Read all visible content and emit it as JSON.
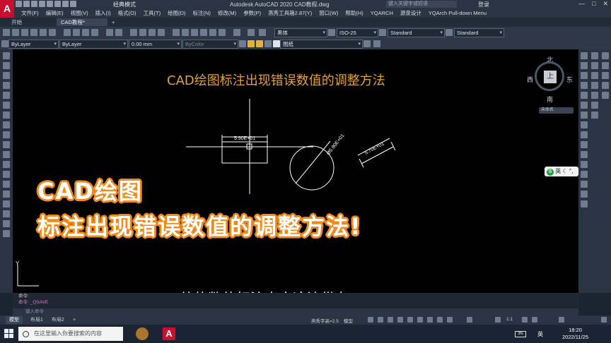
{
  "app": {
    "title": "Autodesk AutoCAD 2020    CAD教程.dwg",
    "logo": "A",
    "workspace": "经典模式",
    "search_placeholder": "键入关键字或短语",
    "login": "登录",
    "window_controls": [
      "—",
      "□",
      "✕"
    ]
  },
  "menu": {
    "items": [
      "文件(F)",
      "编辑(E)",
      "视图(V)",
      "插入(I)",
      "格式(O)",
      "工具(T)",
      "绘图(D)",
      "标注(N)",
      "修改(M)",
      "参数(P)",
      "燕秀工具箱2.87(Y)",
      "窗口(W)",
      "帮助(H)",
      "YQARCH",
      "源泉设计",
      "YQArch Pull-down Menu"
    ]
  },
  "tabs": {
    "start": "开始",
    "doc": "CAD教程*",
    "plus": "+"
  },
  "toolbar": {
    "text_style": "黑体",
    "dim_style": "ISO-25",
    "table_style": "Standard",
    "multileader_style": "Standard",
    "layer_combo": "ByLayer",
    "linetype": "ByLayer",
    "lineweight": "0.00 mm",
    "plot_style": "ByColor",
    "layer_name": "图纸"
  },
  "canvas": {
    "title": "CAD绘图标注出现错误数值的调整方法",
    "dim_linear": "5.90E+01",
    "dim_diameter": "Ø5.90E+01",
    "dim_aligned": "5.70E+01",
    "overlay_line1": "CAD绘图",
    "overlay_line2": "标注出现错误数值的调整方法!",
    "subtitle": "他的数值标注出来这边带有",
    "ucs_label": "Y"
  },
  "viewcube": {
    "north": "北",
    "south": "南",
    "east": "东",
    "west": "西",
    "top": "上",
    "wcs": "未命名"
  },
  "ime": {
    "brand": "S",
    "lang": "英"
  },
  "command": {
    "history": [
      "命令:",
      "命令: _QSAVE"
    ],
    "input_placeholder": "键入命令"
  },
  "status": {
    "layout_tabs": [
      "模型",
      "布局1",
      "布局2",
      "+"
    ],
    "annotation": "燕秀字高=2.5",
    "model": "模型",
    "scale": "1:1"
  },
  "taskbar": {
    "search_placeholder": "在这里输入你要搜索的内容",
    "battery": "3%",
    "lang": "英",
    "time": "18:20",
    "date": "2022/11/25",
    "cad_icon": "A"
  }
}
